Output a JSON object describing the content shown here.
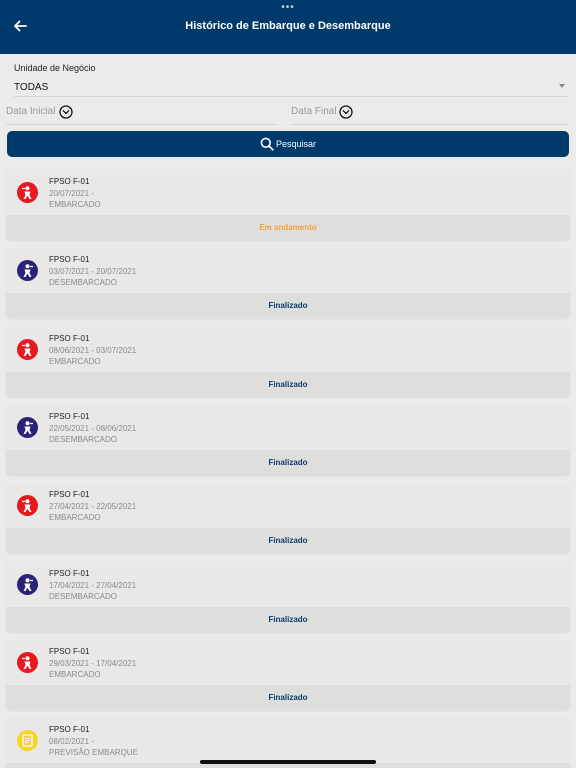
{
  "header": {
    "title": "Histórico de Embarque e Desembarque",
    "dots": "•••"
  },
  "filters": {
    "business_unit_label": "Unidade de Negócio",
    "business_unit_value": "TODAS",
    "start_date_placeholder": "Data Inicial",
    "end_date_placeholder": "Data Final",
    "search_label": "Pesquisar"
  },
  "colors": {
    "header_bg": "#003a6c",
    "embark": "#e5191f",
    "disembark": "#2b237a",
    "forecast": "#f5d328",
    "status_in_progress": "#f0a23c",
    "status_finished": "#0d3c6e"
  },
  "records": [
    {
      "unit": "FPSO F-01",
      "dates": "20/07/2021 -",
      "type": "EMBARCADO",
      "status": "Em andamento",
      "icon": "embark-icon"
    },
    {
      "unit": "FPSO F-01",
      "dates": "03/07/2021 - 20/07/2021",
      "type": "DESEMBARCADO",
      "status": "Finalizado",
      "icon": "disembark-icon"
    },
    {
      "unit": "FPSO F-01",
      "dates": "08/06/2021 - 03/07/2021",
      "type": "EMBARCADO",
      "status": "Finalizado",
      "icon": "embark-icon"
    },
    {
      "unit": "FPSO F-01",
      "dates": "22/05/2021 - 08/06/2021",
      "type": "DESEMBARCADO",
      "status": "Finalizado",
      "icon": "disembark-icon"
    },
    {
      "unit": "FPSO F-01",
      "dates": "27/04/2021 - 22/05/2021",
      "type": "EMBARCADO",
      "status": "Finalizado",
      "icon": "embark-icon"
    },
    {
      "unit": "FPSO F-01",
      "dates": "17/04/2021 - 27/04/2021",
      "type": "DESEMBARCADO",
      "status": "Finalizado",
      "icon": "disembark-icon"
    },
    {
      "unit": "FPSO F-01",
      "dates": "29/03/2021 - 17/04/2021",
      "type": "EMBARCADO",
      "status": "Finalizado",
      "icon": "embark-icon"
    },
    {
      "unit": "FPSO F-01",
      "dates": "08/02/2021 -",
      "type": "PREVISÃO EMBARQUE",
      "status": "",
      "icon": "forecast-icon"
    }
  ]
}
